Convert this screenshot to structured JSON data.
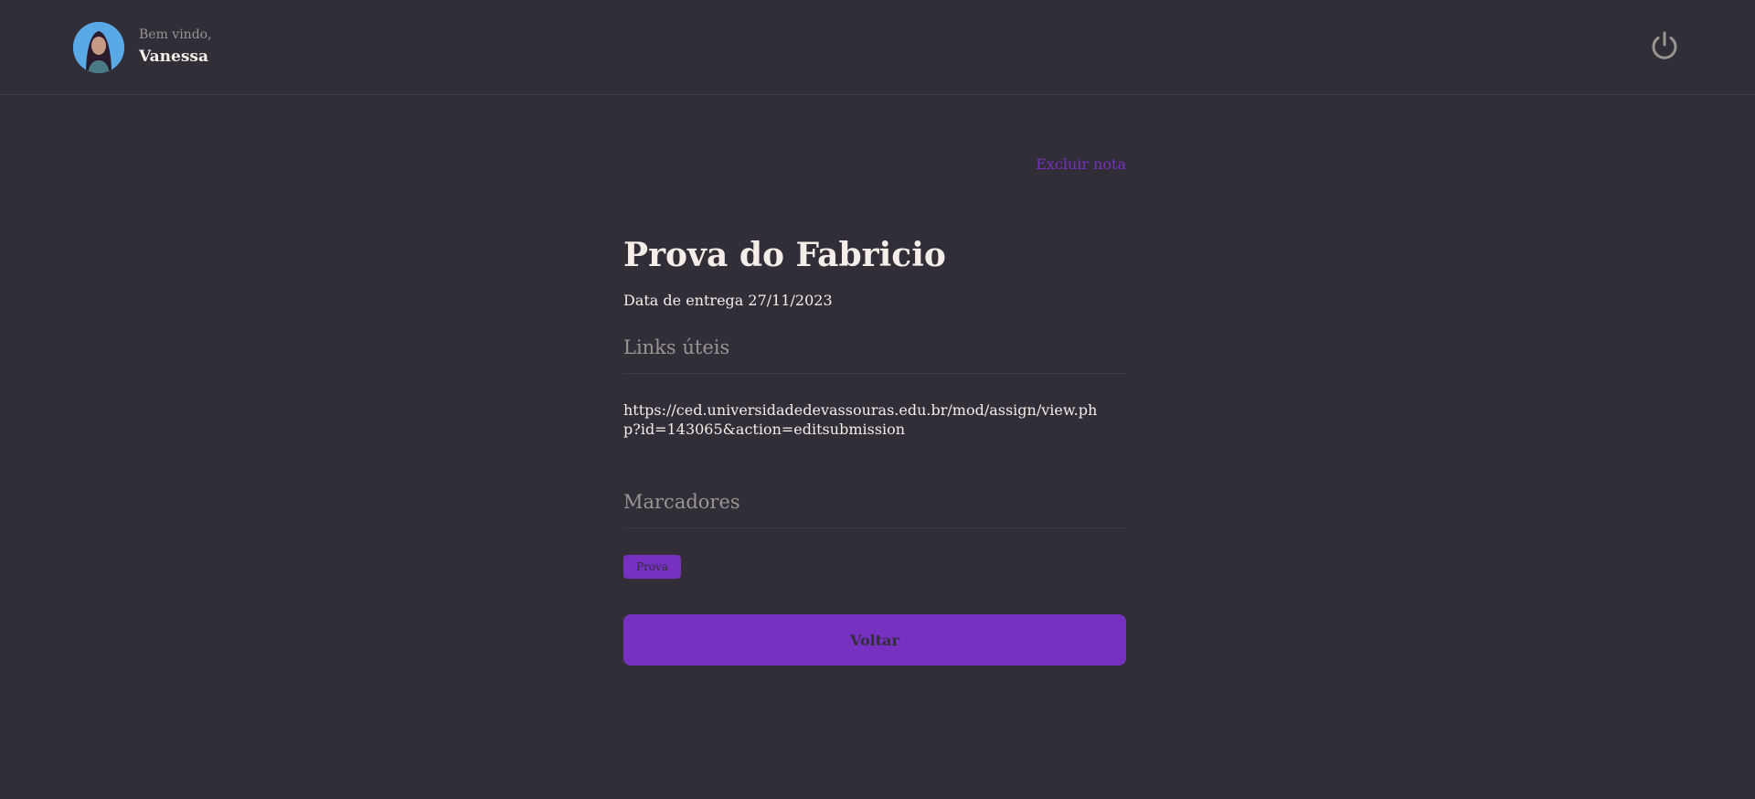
{
  "header": {
    "welcome_label": "Bem vindo,",
    "user_name": "Vanessa",
    "avatar_icon": "user-avatar",
    "logout_icon": "power-icon"
  },
  "note": {
    "delete_label": "Excluir nota",
    "title": "Prova do Fabricio",
    "due_date": "Data de entrega 27/11/2023",
    "links_title": "Links úteis",
    "link": "https://ced.universidadedevassouras.edu.br/mod/assign/view.php?id=143065&action=editsubmission",
    "markers_title": "Marcadores",
    "tags": [
      "Prova"
    ],
    "back_label": "Voltar"
  },
  "colors": {
    "background": "#312e38",
    "accent": "#7631c0",
    "text": "#f4ede8",
    "muted": "#999591",
    "divider": "#3e3b47"
  }
}
